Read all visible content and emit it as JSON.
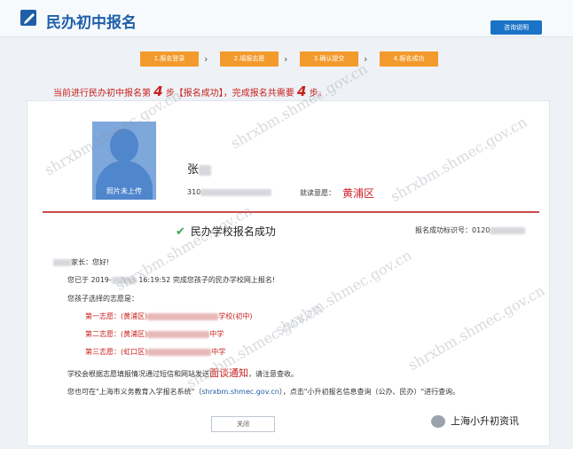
{
  "header": {
    "title": "民办初中报名",
    "help_label": "咨询说明"
  },
  "steps": [
    {
      "label": "1.报名登录"
    },
    {
      "label": "2.填报志愿"
    },
    {
      "label": "3.确认提交"
    },
    {
      "label": "4.报名成功"
    }
  ],
  "progress": {
    "prefix": "当前进行民办初中报名第",
    "current": "4",
    "middle": "步【报名成功】，完成报名共需要",
    "total": "4",
    "suffix": "步。"
  },
  "student": {
    "avatar_label": "照片未上传",
    "name_visible": "张",
    "id_visible": "310",
    "district_label": "就读意愿：",
    "district_value": "黄浦区"
  },
  "result": {
    "title": "民办学校报名成功",
    "id_label": "报名成功标识号：",
    "id_visible": "0120"
  },
  "letter": {
    "greeting": "家长：您好!",
    "line1_prefix": "您已于 2019-",
    "line1_suffix": "16:19:52 完成您孩子的民办学校网上报名!",
    "choices_intro": "您孩子选择的志愿是：",
    "choices": [
      {
        "prefix": "第一志愿：(黄浦区)",
        "suffix": "学校(初中)"
      },
      {
        "prefix": "第二志愿：(黄浦区)",
        "suffix": "中学"
      },
      {
        "prefix": "第三志愿：(虹口区)",
        "suffix": "中学"
      }
    ],
    "notice_prefix": "学校会根据志愿填报情况通过短信和网站发送",
    "notice_highlight": "面谈通知",
    "notice_suffix": "，请注意查收。",
    "query_prefix": "您也可在\"上海市义务教育入学报名系统\"（",
    "query_link": "shrxbm.shmec.gov.cn",
    "query_suffix": "），点击\"小升初报名信息查询（公办、民办）\"进行查询。"
  },
  "close_label": "关闭",
  "watermark": "shrxbm.shmec.gov.cn",
  "wechat_label": "上海小升初资讯",
  "colors": {
    "step_orange": "#f39a2d",
    "accent_red": "#c8201e",
    "primary_blue": "#1a73c6"
  }
}
